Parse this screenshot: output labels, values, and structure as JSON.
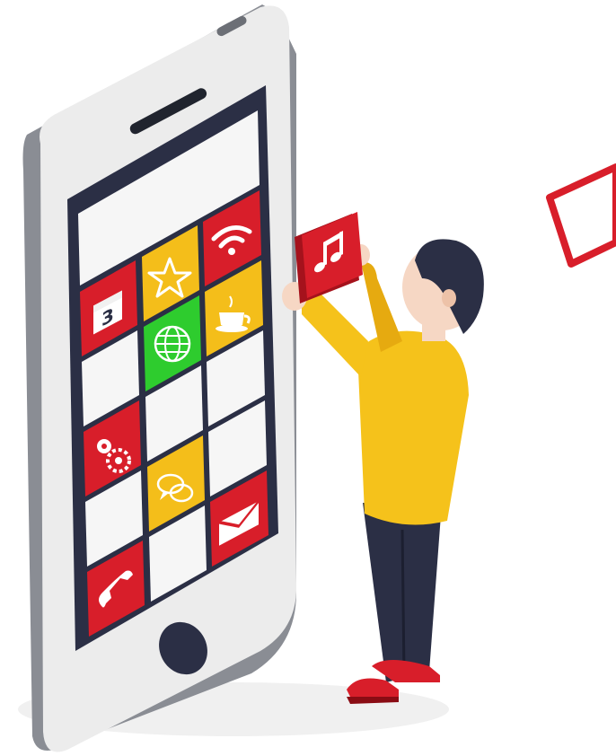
{
  "scene": {
    "background": "#ffffff",
    "colors": {
      "red": "#d81e2a",
      "red_dark": "#a5121c",
      "yellow": "#f4be1a",
      "yellow_shirt": "#f5c21b",
      "green": "#2ecc2e",
      "navy": "#2b2f45",
      "phone_body": "#ececec",
      "phone_side": "#8a8d94",
      "tile_white": "#f6f6f6"
    },
    "phone": {
      "screen_tiles": [
        {
          "id": "blank-top-wide",
          "color": "tile_white",
          "icon": ""
        },
        {
          "id": "calendar",
          "color": "red",
          "icon": "calendar-icon",
          "text": "3"
        },
        {
          "id": "star",
          "color": "yellow",
          "icon": "star-icon"
        },
        {
          "id": "wifi",
          "color": "red",
          "icon": "wifi-icon"
        },
        {
          "id": "globe",
          "color": "green",
          "icon": "globe-icon"
        },
        {
          "id": "coffee",
          "color": "yellow",
          "icon": "coffee-cup-icon"
        },
        {
          "id": "settings",
          "color": "red",
          "icon": "gears-icon"
        },
        {
          "id": "chat",
          "color": "yellow",
          "icon": "chat-bubbles-icon"
        },
        {
          "id": "mail",
          "color": "red",
          "icon": "envelope-icon"
        },
        {
          "id": "phone",
          "color": "red",
          "icon": "phone-handset-icon"
        }
      ]
    },
    "person": {
      "holding": "music-note-icon",
      "shirt_color": "yellow_shirt",
      "pants_color": "navy",
      "shoes_color": "red"
    },
    "calendar_day": "3"
  }
}
